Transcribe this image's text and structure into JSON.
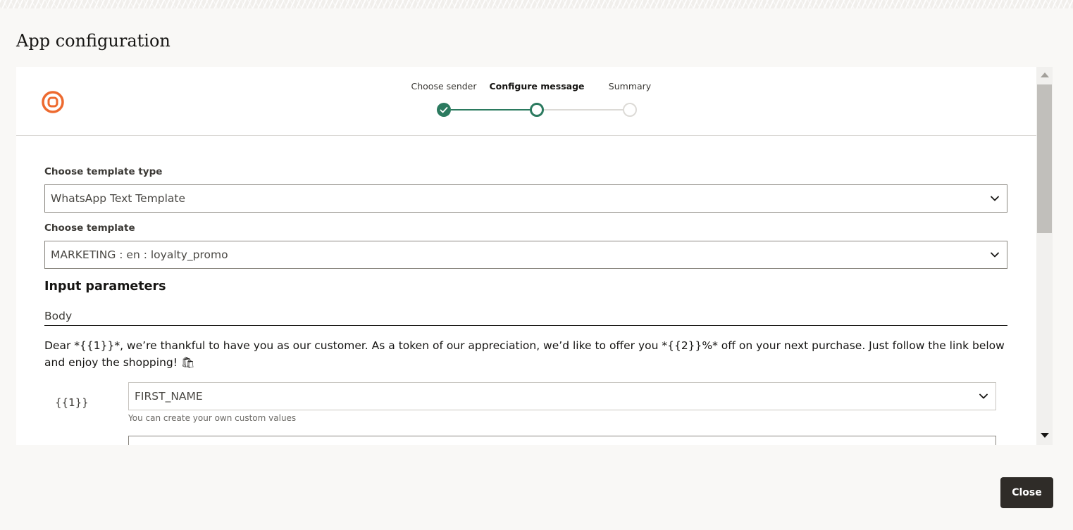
{
  "page": {
    "title": "App configuration"
  },
  "stepper": {
    "steps": [
      {
        "label": "Choose sender",
        "state": "completed"
      },
      {
        "label": "Configure message",
        "state": "active"
      },
      {
        "label": "Summary",
        "state": "pending"
      }
    ]
  },
  "form": {
    "template_type": {
      "label": "Choose template type",
      "value": "WhatsApp Text Template"
    },
    "template": {
      "label": "Choose template",
      "value": "MARKETING : en : loyalty_promo"
    },
    "input_parameters": {
      "title": "Input parameters",
      "tab": "Body",
      "body_text": "Dear *{{1}}*, we’re thankful to have you as our customer. As a token of our appreciation, we’d like to offer you *{{2}}%* off on your next purchase. Just follow the link below and enjoy the shopping! 🛍",
      "params": [
        {
          "placeholder": "{{1}}",
          "value": "FIRST_NAME",
          "helper": "You can create your own custom values"
        }
      ]
    }
  },
  "footer": {
    "close_label": "Close"
  },
  "colors": {
    "accent_green": "#2b7a5f",
    "logo_orange": "#ed6a2f",
    "button_dark": "#2f2c28"
  }
}
